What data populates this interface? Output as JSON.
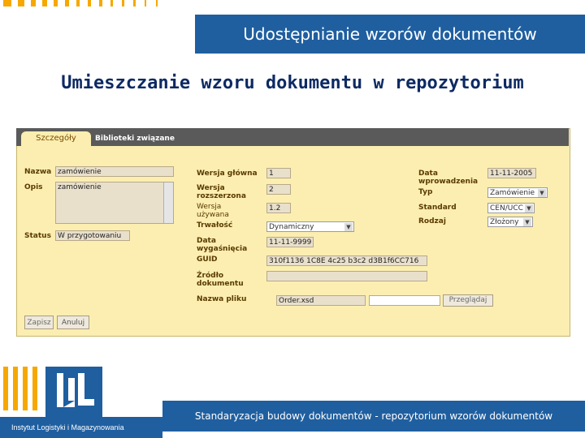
{
  "header": {
    "banner": "Udostępnianie wzorów dokumentów",
    "title": "Umieszczanie wzoru dokumentu w repozytorium"
  },
  "tabs": [
    {
      "label": "Szczegóły"
    },
    {
      "label": "Biblioteki związane"
    }
  ],
  "form": {
    "nazwa": {
      "label": "Nazwa",
      "value": "zamówienie"
    },
    "opis": {
      "label": "Opis",
      "value": "zamówienie"
    },
    "status": {
      "label": "Status",
      "value": "W przygotowaniu"
    },
    "wersja_glowna": {
      "label": "Wersja główna",
      "value": "1"
    },
    "wersja_rozszerzona": {
      "label": "Wersja rozszerzona",
      "value": "2"
    },
    "wersja_uzywana": {
      "label": "Wersja używana",
      "value": "1.2"
    },
    "trwalosc": {
      "label": "Trwałość",
      "value": "Dynamiczny"
    },
    "data_wygasniecia": {
      "label": "Data wygaśnięcia",
      "value": "11-11-9999"
    },
    "guid": {
      "label": "GUID",
      "value": "310f1136 1C8E 4c25 b3c2 d3B1f6CC716"
    },
    "zrodlo": {
      "label": "Źródło dokumentu",
      "value": ""
    },
    "nazwa_pliku": {
      "label": "Nazwa pliku",
      "value": "Order.xsd",
      "browse": "Przeglądaj"
    },
    "data_wprowadzenia": {
      "label": "Data wprowadzenia",
      "value": "11-11-2005"
    },
    "typ": {
      "label": "Typ",
      "value": "Zamówienie"
    },
    "standard": {
      "label": "Standard",
      "value": "CEN/UCC"
    },
    "rodzaj": {
      "label": "Rodzaj",
      "value": "Złożony"
    }
  },
  "buttons": {
    "save": "Zapisz",
    "cancel": "Anuluj"
  },
  "footer": {
    "caption": "Standaryzacja budowy dokumentów - repozytorium wzorów dokumentów",
    "institute": "Instytut Logistyki i Magazynowania"
  },
  "colors": {
    "accent": "#f6a800",
    "brand_blue": "#1f5fa0",
    "panel": "#fbeeb0",
    "title": "#0d2a63"
  }
}
